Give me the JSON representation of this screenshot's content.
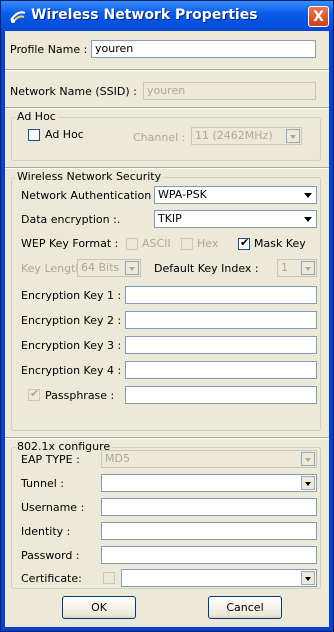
{
  "window": {
    "title": "Wireless Network Properties",
    "close_glyph": "X",
    "icon": "wireless-icon"
  },
  "profile": {
    "label": "Profile Name :",
    "value": "youren"
  },
  "ssid": {
    "label": "Network Name (SSID) :",
    "value": "youren"
  },
  "adhoc": {
    "group_title": "Ad Hoc",
    "checkbox_label": "Ad Hoc",
    "checked": false,
    "channel_label": "Channel :",
    "channel_value": "11 (2462MHz)"
  },
  "security": {
    "group_title": "Wireless Network Security",
    "auth_label": "Network Authentication :",
    "auth_value": "WPA-PSK",
    "enc_label": "Data encryption :.",
    "enc_value": "TKIP",
    "wep_format_label": "WEP Key Format :",
    "ascii_label": "ASCII",
    "ascii_checked": false,
    "hex_label": "Hex",
    "hex_checked": false,
    "mask_label": "Mask Key",
    "mask_checked": true,
    "key_length_label": "Key Length :",
    "key_length_value": "64 Bits",
    "default_index_label": "Default Key Index :",
    "default_index_value": "1",
    "keys": [
      {
        "label": "Encryption Key 1 :",
        "value": ""
      },
      {
        "label": "Encryption Key 2 :",
        "value": ""
      },
      {
        "label": "Encryption Key 3 :",
        "value": ""
      },
      {
        "label": "Encryption Key 4 :",
        "value": ""
      }
    ],
    "passphrase_label": "Passphrase :",
    "passphrase_checked": true,
    "passphrase_value": ""
  },
  "dot1x": {
    "group_title": "802.1x configure",
    "eap_label": "EAP TYPE :",
    "eap_value": "MD5",
    "tunnel_label": "Tunnel :",
    "tunnel_value": "",
    "username_label": "Username :",
    "username_value": "",
    "identity_label": "Identity :",
    "identity_value": "",
    "password_label": "Password :",
    "password_value": "",
    "certificate_label": "Certificate:",
    "certificate_checked": false,
    "certificate_value": ""
  },
  "buttons": {
    "ok": "OK",
    "cancel": "Cancel"
  },
  "colors": {
    "titlebar": "#0a5ce7",
    "dialog_bg": "#ece9d8",
    "close": "#c7421b"
  }
}
